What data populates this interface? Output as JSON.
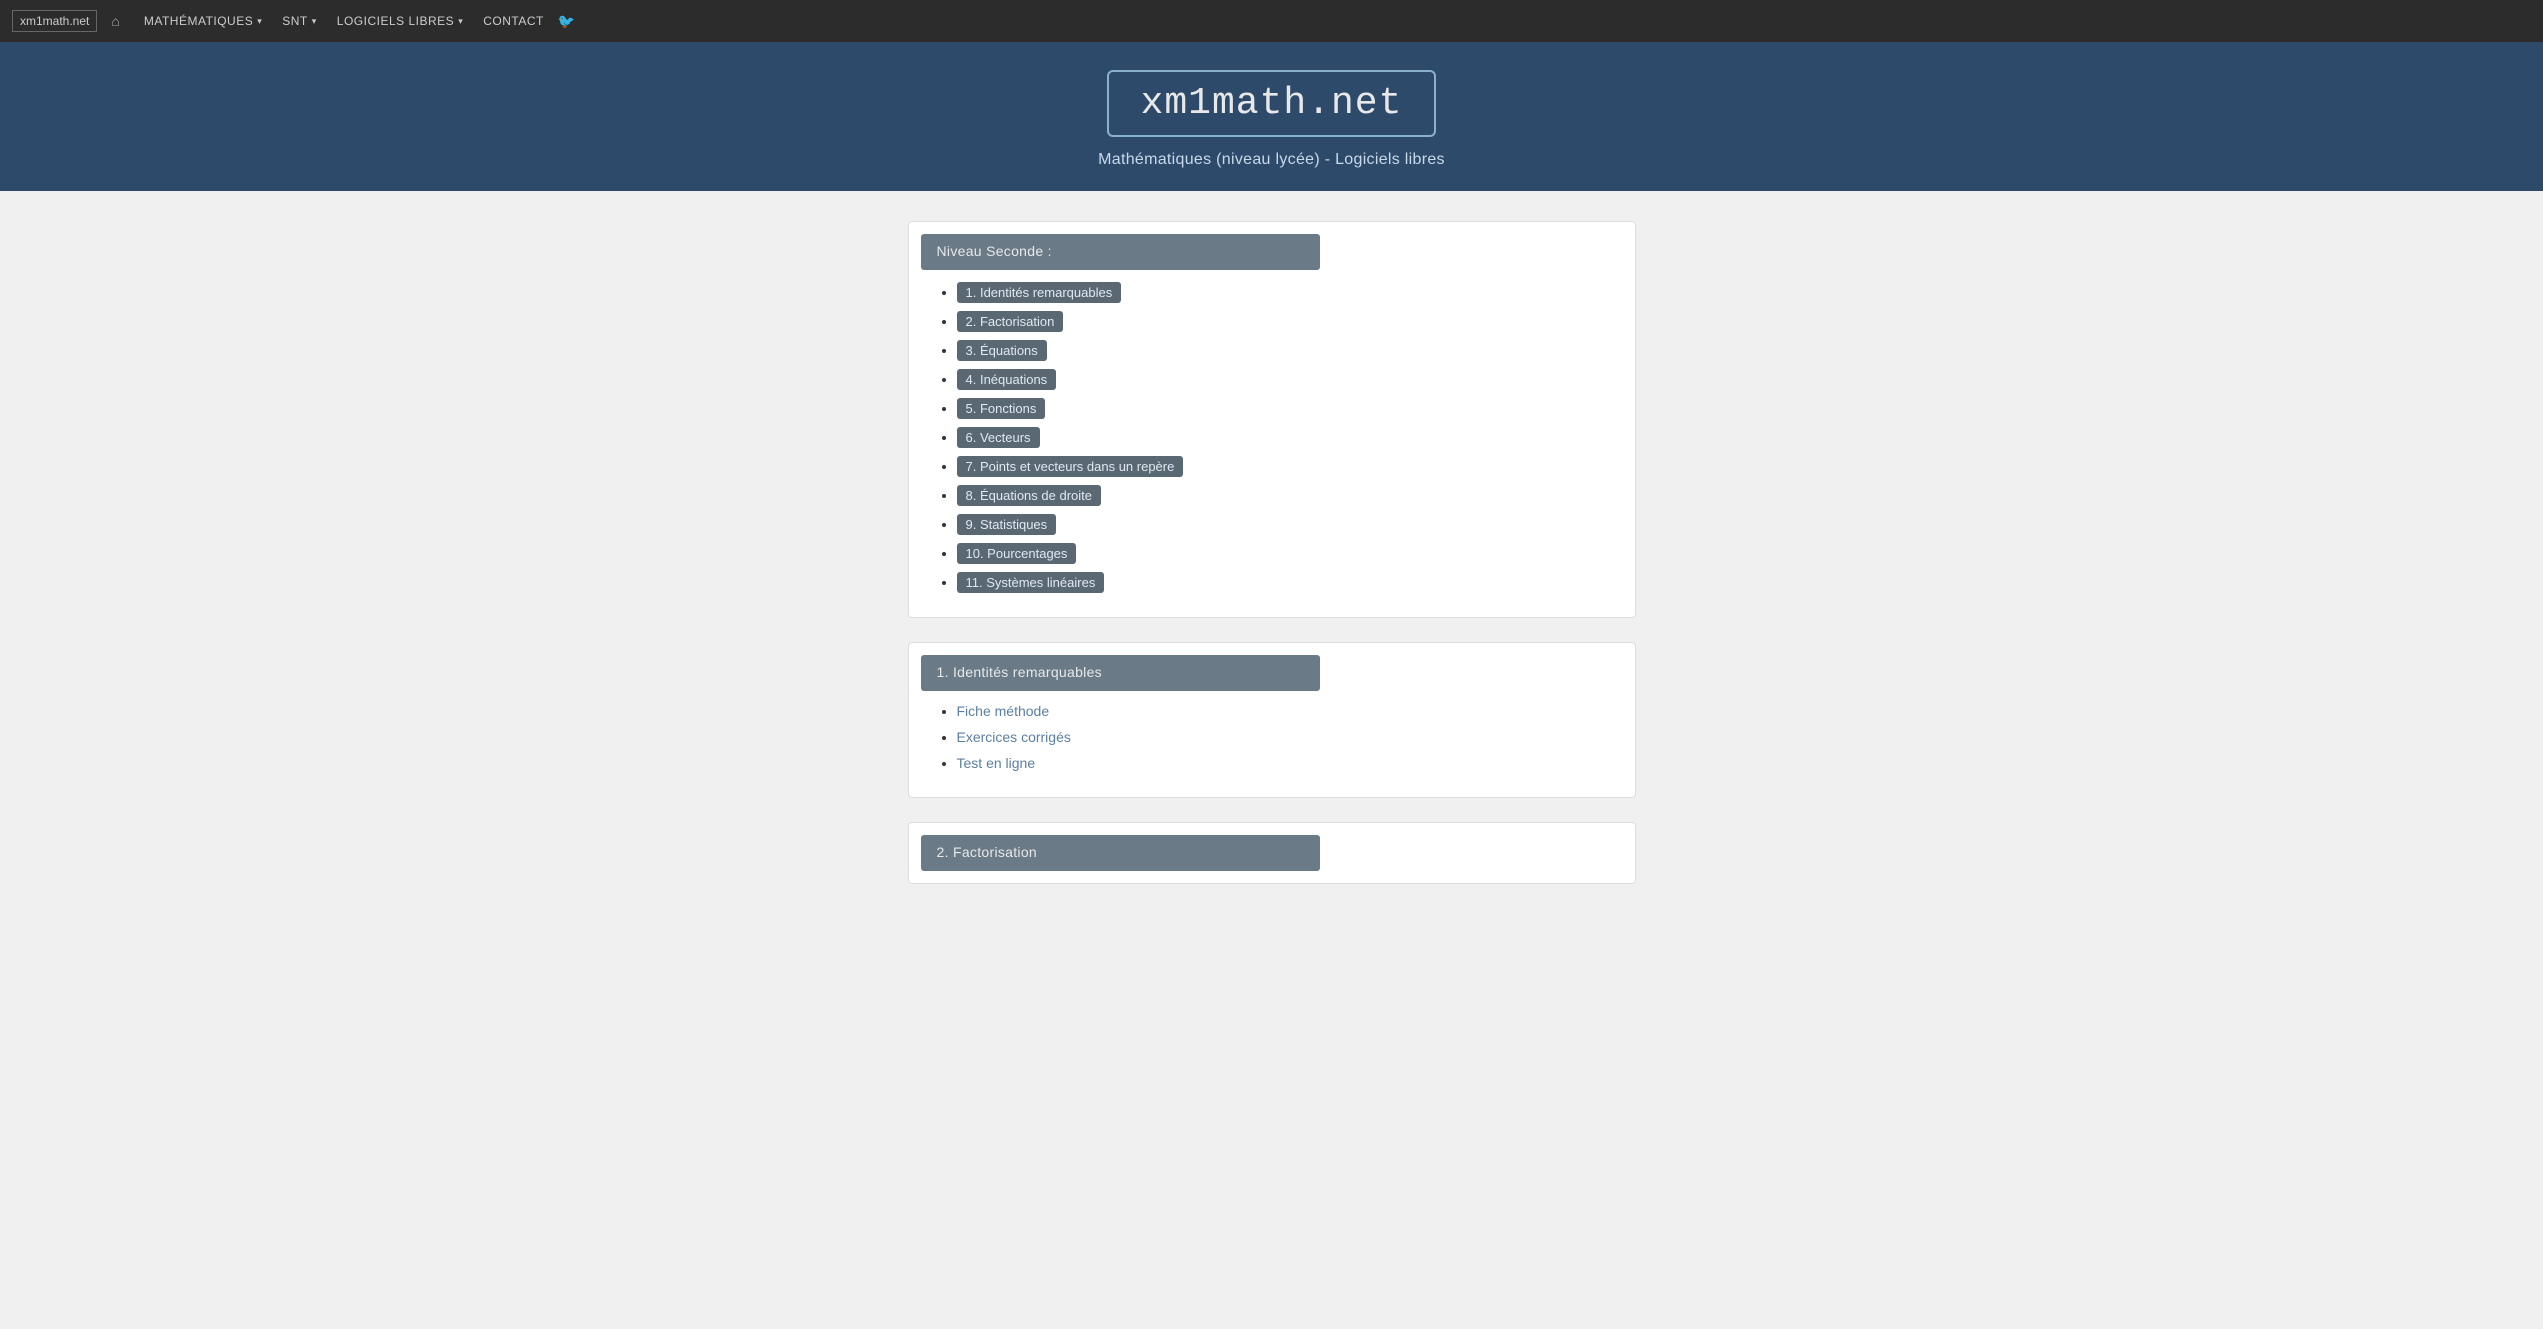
{
  "nav": {
    "brand": "xm1math.net",
    "home_icon": "⌂",
    "items": [
      {
        "label": "MATHÉMATIQUES",
        "has_dropdown": true
      },
      {
        "label": "SNT",
        "has_dropdown": true
      },
      {
        "label": "LOGICIELS LIBRES",
        "has_dropdown": true
      },
      {
        "label": "CONTACT",
        "has_dropdown": false
      }
    ],
    "twitter_icon": "🐦"
  },
  "header": {
    "logo": "xm1math.net",
    "subtitle": "Mathématiques (niveau lycée) - Logiciels libres"
  },
  "niveau_seconde": {
    "title": "Niveau Seconde :",
    "items": [
      "1. Identités remarquables",
      "2. Factorisation",
      "3. Équations",
      "4. Inéquations",
      "5. Fonctions",
      "6. Vecteurs",
      "7. Points et vecteurs dans un repère",
      "8. Équations de droite",
      "9. Statistiques",
      "10. Pourcentages",
      "11. Systèmes linéaires"
    ]
  },
  "section_identites": {
    "title": "1. Identités remarquables",
    "links": [
      "Fiche méthode",
      "Exercices corrigés",
      "Test en ligne"
    ]
  },
  "section_factorisation": {
    "title": "2. Factorisation"
  }
}
